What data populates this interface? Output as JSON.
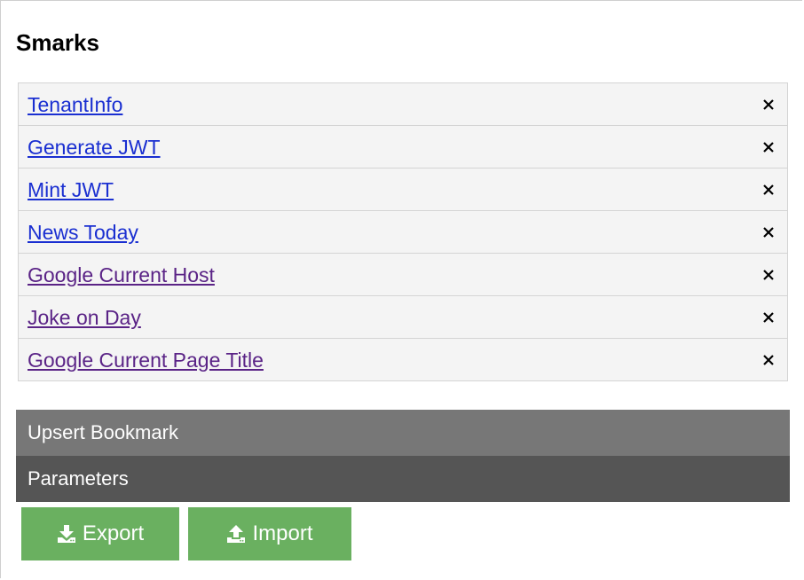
{
  "page": {
    "title": "Smarks"
  },
  "bookmarks": [
    {
      "label": "TenantInfo",
      "visited": false
    },
    {
      "label": "Generate JWT",
      "visited": false
    },
    {
      "label": "Mint JWT",
      "visited": false
    },
    {
      "label": "News Today",
      "visited": false
    },
    {
      "label": "Google Current Host",
      "visited": true
    },
    {
      "label": "Joke on Day",
      "visited": true
    },
    {
      "label": "Google Current Page Title",
      "visited": true
    }
  ],
  "icons": {
    "remove": "close-icon",
    "export": "download-icon",
    "import": "upload-icon"
  },
  "sections": {
    "upsert_label": "Upsert Bookmark",
    "parameters_label": "Parameters"
  },
  "actions": {
    "export_label": "Export",
    "import_label": "Import"
  },
  "colors": {
    "link": "#1a2fd1",
    "visited_link": "#5a2386",
    "upsert_bar": "#777777",
    "parameters_bar": "#555555",
    "action_button": "#6ab060"
  }
}
